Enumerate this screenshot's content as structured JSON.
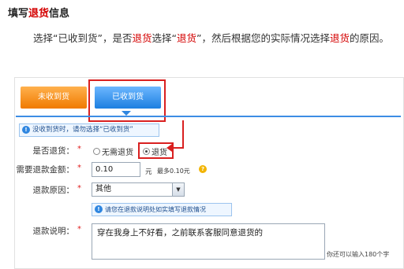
{
  "article": {
    "heading_pre": "填写",
    "heading_red": "退货",
    "heading_post": "信息",
    "intro_parts": [
      "选择“已收到货”，是否",
      "退货",
      "选择“",
      "退货",
      "”，然后根据您的实际情况选择",
      "退货",
      "的原因。"
    ]
  },
  "tabs": [
    {
      "label": "未收到货"
    },
    {
      "label": "已收到货"
    }
  ],
  "notice": "没收到货时，请勿选择“已收到货”",
  "form": {
    "return_label": "是否退货：",
    "option_no": "无需退货",
    "option_yes": "退货",
    "amount_label": "需要退款金额：",
    "amount_value": "0.10",
    "amount_unit": "元",
    "max_text": "最多0.10元",
    "reason_label": "退款原因：",
    "reason_value": "其他",
    "tip_text": "请您在退款说明处如实填写退款情况",
    "desc_label": "退款说明：",
    "desc_value": "穿在我身上不好看，之前联系客服同意退货的",
    "char_hint": "你还可以输入180个字",
    "required_mark": "*"
  },
  "colors": {
    "accent_red": "#d40000",
    "tab_orange": "#f07a00",
    "tab_blue": "#1d7fe0"
  }
}
